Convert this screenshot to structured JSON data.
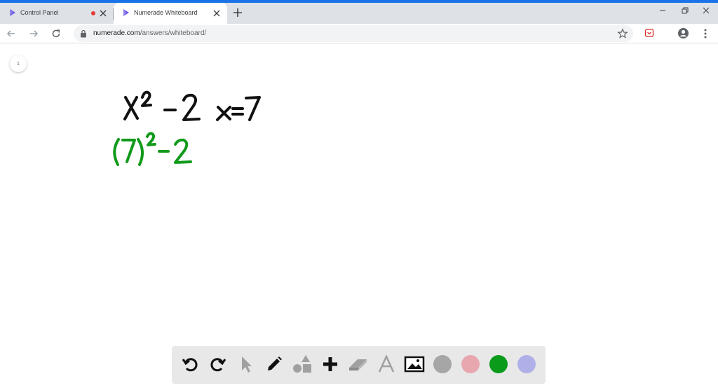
{
  "browser": {
    "tabs": [
      {
        "title": "Control Panel",
        "active": false
      },
      {
        "title": "Numerade Whiteboard",
        "active": true
      }
    ],
    "url_host": "numerade.com",
    "url_path": "/answers/whiteboard/"
  },
  "whiteboard": {
    "page_number": "1"
  },
  "palette": {
    "tools": [
      "undo-icon",
      "redo-icon",
      "select-pointer-icon",
      "pencil-icon",
      "shapes-icon",
      "plus-icon",
      "eraser-icon",
      "text-icon",
      "image-icon"
    ],
    "colors": [
      "#a6a6a6",
      "#e8a7ae",
      "#0a9b1a",
      "#b0b0e8"
    ]
  },
  "colors": {
    "accent": "#1a73e8",
    "ink_black": "#111111",
    "ink_green": "#119a1b"
  }
}
